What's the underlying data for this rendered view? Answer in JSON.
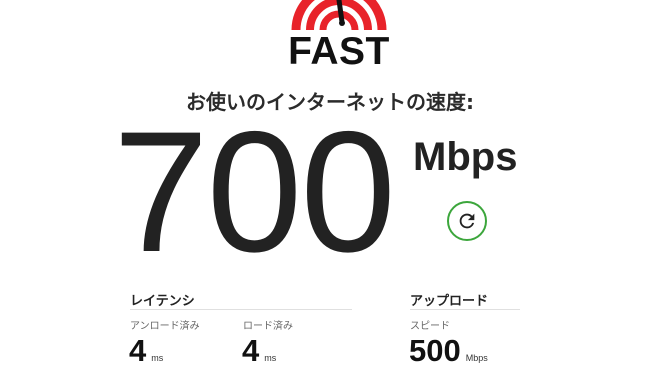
{
  "logo": {
    "text": "FAST",
    "accent_color": "#e8232a"
  },
  "heading": "お使いのインターネットの速度:",
  "speed": {
    "value": "700",
    "unit": "Mbps"
  },
  "refresh": {
    "icon": "refresh-icon",
    "color": "#3ca63c"
  },
  "latency": {
    "title": "レイテンシ",
    "unloaded": {
      "label": "アンロード済み",
      "value": "4",
      "unit": "ms"
    },
    "loaded": {
      "label": "ロード済み",
      "value": "4",
      "unit": "ms"
    }
  },
  "upload": {
    "title": "アップロード",
    "speed": {
      "label": "スピード",
      "value": "500",
      "unit": "Mbps"
    }
  }
}
